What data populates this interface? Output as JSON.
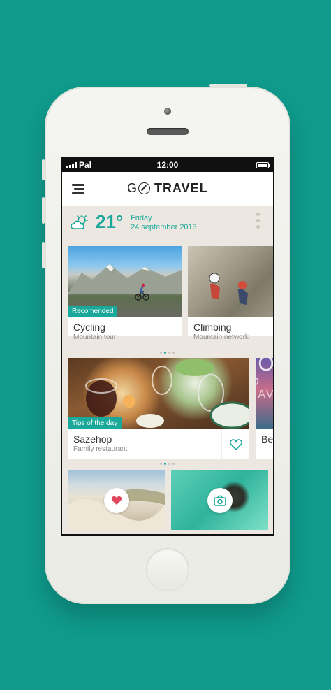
{
  "status": {
    "carrier": "Pal",
    "time": "12:00",
    "battery_level": 1.0
  },
  "app": {
    "logo_go": "GO",
    "logo_travel": "TRAVEL"
  },
  "weather": {
    "icon": "partly-cloudy-icon",
    "temperature": "21°",
    "day": "Friday",
    "date": "24 september 2013"
  },
  "row1": {
    "cards": [
      {
        "image": "cycling-photo",
        "tag": "Recomended",
        "title": "Cycling",
        "subtitle": "Mountain tour"
      },
      {
        "image": "climbing-photo",
        "title": "Climbing",
        "subtitle": "Mountain network"
      }
    ],
    "pager": {
      "count": 4,
      "active": 1
    }
  },
  "row2": {
    "cards": [
      {
        "image": "restaurant-photo",
        "tag": "Tips of the day",
        "title": "Sazehop",
        "subtitle": "Family restaurant",
        "action_icon": "heart-outline-icon"
      },
      {
        "image": "partial-photo",
        "title": "Be",
        "overlay_text": "GO TRAV"
      }
    ],
    "pager": {
      "count": 4,
      "active": 1
    }
  },
  "row3": {
    "cards": [
      {
        "image": "dunes-photo",
        "action_icon": "heart-filled-icon"
      },
      {
        "image": "seal-photo",
        "action_icon": "camera-icon"
      }
    ]
  },
  "colors": {
    "background": "#0f9a8b",
    "accent": "#1aa89a",
    "screen_bg": "#ece8e1"
  }
}
